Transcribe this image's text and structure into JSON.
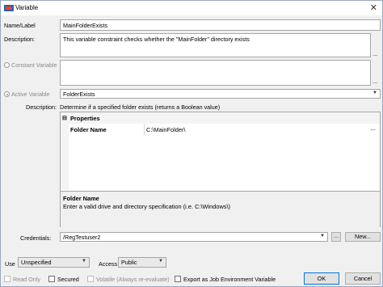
{
  "window": {
    "title": "Variable"
  },
  "name_label": {
    "label": "Name/Label",
    "value": "MainFolderExists"
  },
  "description": {
    "label": "Description:",
    "value": "This variable constraint checks whether the \"MainFolder\" directory exists"
  },
  "constant_variable": {
    "label": "Constant Variable",
    "value": ""
  },
  "active_variable": {
    "label": "Active Variable",
    "selected": "FolderExists"
  },
  "active_description": {
    "label": "Description:",
    "value": "Determine if a specified folder exists (returns a Boolean value)"
  },
  "properties": {
    "header": "Properties",
    "rows": [
      {
        "name": "Folder Name",
        "value": "C:\\MainFolder\\"
      }
    ],
    "help_title": "Folder Name",
    "help_text": "Enter a valid drive and directory specification (i.e. C:\\Windows\\)"
  },
  "credentials": {
    "label": "Credentials:",
    "value": "/RegTestuser2",
    "browse": "...",
    "new_label": "New..."
  },
  "use": {
    "label": "Use",
    "selected": "Unspecified"
  },
  "access": {
    "label": "Access",
    "selected": "Public"
  },
  "options": {
    "read_only": "Read Only",
    "secured": "Secured",
    "volatile": "Volatile (Always re-evaluate)",
    "export": "Export as Job Environment Variable"
  },
  "buttons": {
    "ok": "OK",
    "cancel": "Cancel"
  },
  "glyphs": {
    "ellipsis": "...",
    "close": "✕",
    "dropdown": "▼",
    "collapse": "⊟"
  }
}
